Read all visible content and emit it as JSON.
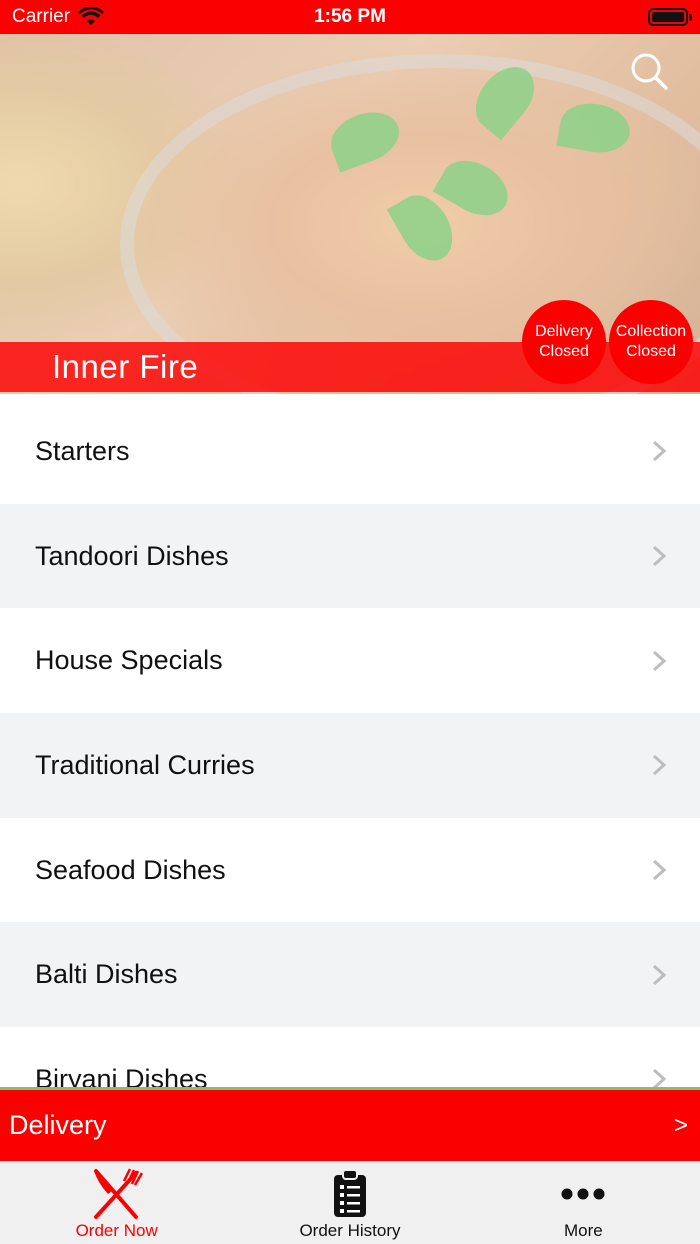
{
  "status_bar": {
    "carrier": "Carrier",
    "time": "1:56 PM"
  },
  "hero": {
    "restaurant_name": "Inner Fire",
    "delivery_status_line1": "Delivery",
    "delivery_status_line2": "Closed",
    "collection_status_line1": "Collection",
    "collection_status_line2": "Closed"
  },
  "categories": [
    {
      "label": "Starters"
    },
    {
      "label": "Tandoori Dishes"
    },
    {
      "label": "House Specials"
    },
    {
      "label": "Traditional Curries"
    },
    {
      "label": "Seafood Dishes"
    },
    {
      "label": "Balti Dishes"
    },
    {
      "label": "Biryani Dishes"
    }
  ],
  "delivery_bar": {
    "label": "Delivery",
    "arrow": ">"
  },
  "tab_bar": {
    "tabs": [
      {
        "label": "Order Now",
        "icon": "fork-knife-icon",
        "active": true
      },
      {
        "label": "Order History",
        "icon": "clipboard-list-icon",
        "active": false
      },
      {
        "label": "More",
        "icon": "more-dots-icon",
        "active": false
      }
    ]
  },
  "colors": {
    "brand_red": "#fb0000",
    "divider_green": "#7cc46a"
  }
}
